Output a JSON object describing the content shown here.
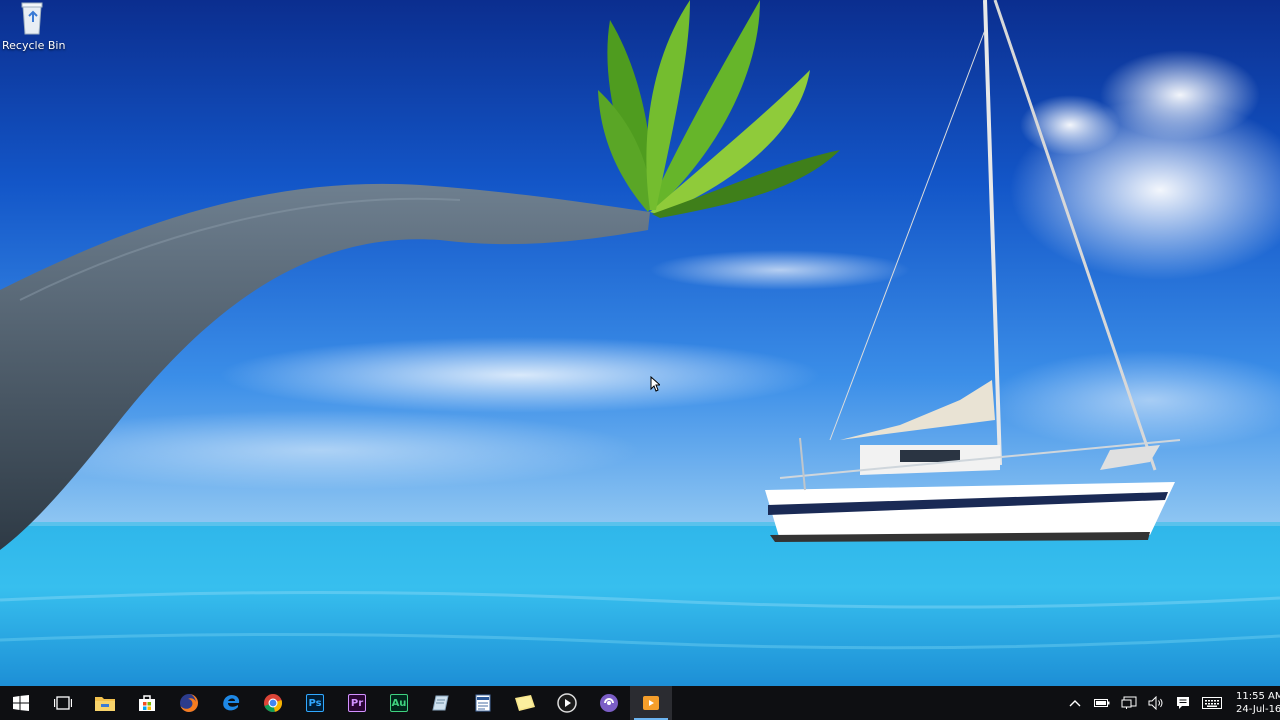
{
  "desktop": {
    "icons": [
      {
        "label": "Recycle Bin",
        "icon": "recycle-bin-icon"
      }
    ],
    "wallpaper": "tropical-beach-palm-sailboat"
  },
  "taskbar": {
    "start": {
      "icon": "windows-logo-icon"
    },
    "task_view": {
      "icon": "task-view-icon"
    },
    "apps": [
      {
        "icon": "file-explorer-icon"
      },
      {
        "icon": "windows-store-icon"
      },
      {
        "icon": "firefox-icon"
      },
      {
        "icon": "edge-icon"
      },
      {
        "icon": "chrome-icon"
      },
      {
        "icon": "photoshop-icon",
        "text": "Ps",
        "color": "#31a8ff"
      },
      {
        "icon": "premiere-icon",
        "text": "Pr",
        "color": "#d291ff"
      },
      {
        "icon": "audition-icon",
        "text": "Au",
        "color": "#3fd27f"
      },
      {
        "icon": "notepad-icon"
      },
      {
        "icon": "wordpad-icon"
      },
      {
        "icon": "sticky-notes-icon"
      },
      {
        "icon": "media-player-icon"
      },
      {
        "icon": "torrent-client-icon"
      },
      {
        "icon": "video-app-icon",
        "active": true
      }
    ],
    "tray": [
      {
        "icon": "chevron-up-icon"
      },
      {
        "icon": "battery-icon"
      },
      {
        "icon": "network-icon"
      },
      {
        "icon": "volume-icon"
      },
      {
        "icon": "action-center-icon"
      },
      {
        "icon": "keyboard-icon"
      }
    ],
    "clock": {
      "time": "11:55 AM",
      "date": "24-Jul-16"
    }
  },
  "colors": {
    "taskbar_bg": "#0e0f12",
    "active_indicator": "#6cb4f0"
  }
}
